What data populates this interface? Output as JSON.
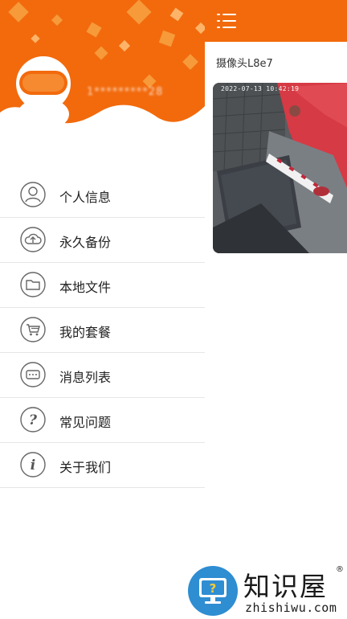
{
  "drawer": {
    "user_id": "1*********28",
    "menu": [
      {
        "label": "个人信息",
        "icon": "user-icon"
      },
      {
        "label": "永久备份",
        "icon": "cloud-upload-icon"
      },
      {
        "label": "本地文件",
        "icon": "folder-icon"
      },
      {
        "label": "我的套餐",
        "icon": "cart-icon"
      },
      {
        "label": "消息列表",
        "icon": "message-icon"
      },
      {
        "label": "常见问题",
        "icon": "help-icon"
      },
      {
        "label": "关于我们",
        "icon": "info-icon"
      }
    ]
  },
  "main": {
    "camera_title": "摄像头L8e7",
    "camera_timestamp": "2022-07-13  10:42:19"
  },
  "watermark": {
    "brand": "知识屋",
    "registered": "®",
    "domain": "zhishiwu.com"
  },
  "colors": {
    "accent": "#f26a0c",
    "accent_light": "#f7a040",
    "badge": "#2f8dd2"
  }
}
